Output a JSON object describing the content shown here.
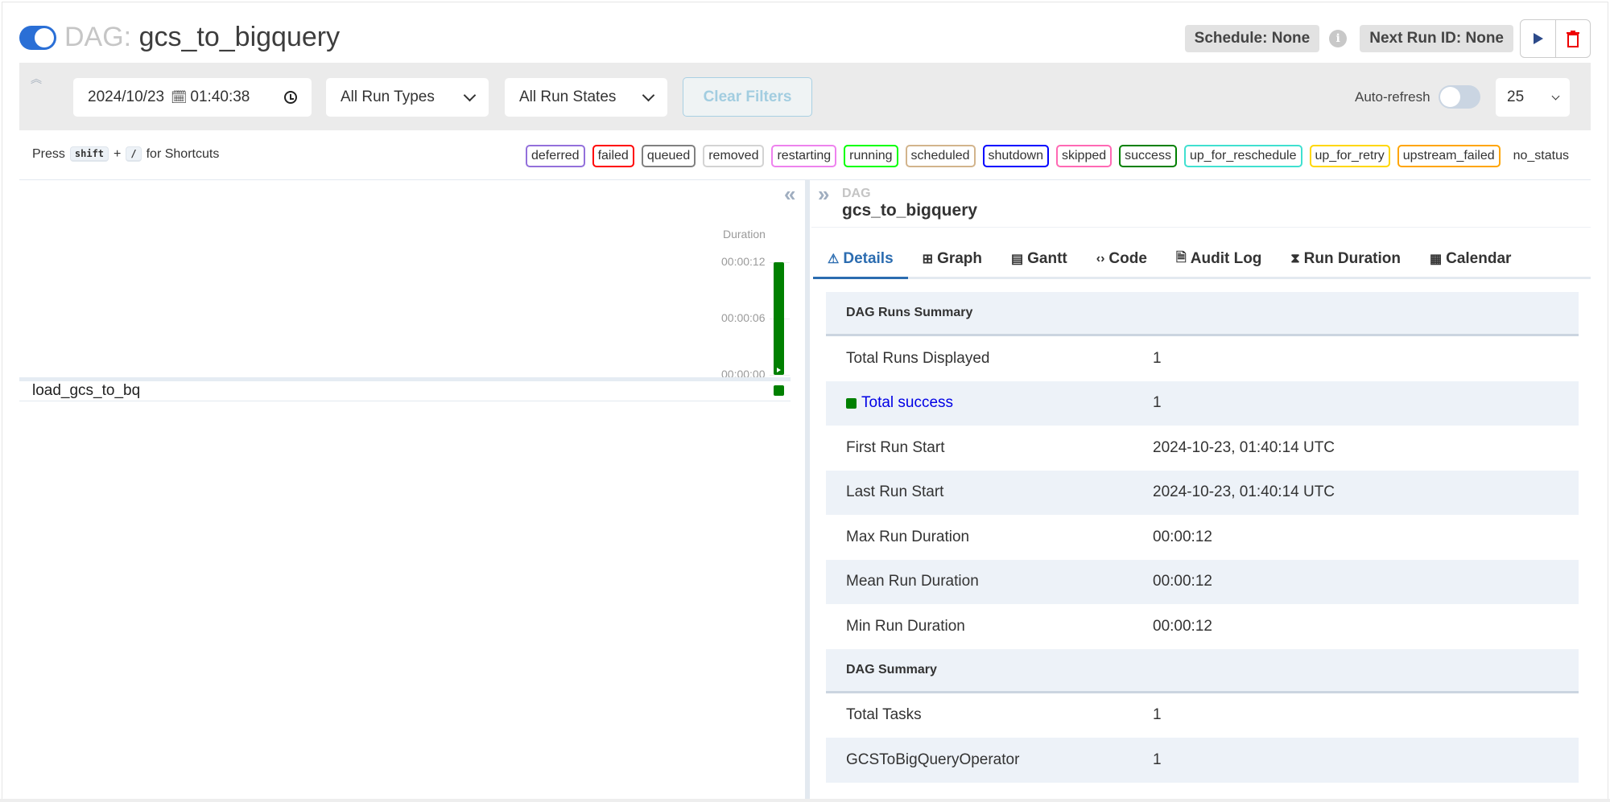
{
  "header": {
    "dag_prefix": "DAG:",
    "dag_id": "gcs_to_bigquery",
    "schedule": "Schedule: None",
    "next_run": "Next Run ID: None",
    "info_glyph": "i",
    "icons": {
      "toggle": "dag-active-toggle",
      "trigger": "play-icon",
      "delete": "trash-icon",
      "info": "info-icon"
    }
  },
  "filters": {
    "date": "2024/10/23",
    "time": "01:40:38",
    "run_types": "All Run Types",
    "run_states": "All Run States",
    "clear_label": "Clear Filters",
    "auto_refresh_label": "Auto-refresh",
    "auto_refresh_on": false,
    "num_runs": "25"
  },
  "shortcuts": {
    "press": "Press",
    "key1": "shift",
    "plus": "+",
    "key2": "/",
    "suffix": "for Shortcuts"
  },
  "states": [
    {
      "label": "deferred",
      "color": "#9370db"
    },
    {
      "label": "failed",
      "color": "#ff0000"
    },
    {
      "label": "queued",
      "color": "#808080"
    },
    {
      "label": "removed",
      "color": "#d3d3d3"
    },
    {
      "label": "restarting",
      "color": "#ee82ee"
    },
    {
      "label": "running",
      "color": "#00ff00"
    },
    {
      "label": "scheduled",
      "color": "#d2b48c"
    },
    {
      "label": "shutdown",
      "color": "#0000ff"
    },
    {
      "label": "skipped",
      "color": "#ff69b4"
    },
    {
      "label": "success",
      "color": "#008000"
    },
    {
      "label": "up_for_reschedule",
      "color": "#40e0d0"
    },
    {
      "label": "up_for_retry",
      "color": "#ffd700"
    },
    {
      "label": "upstream_failed",
      "color": "#ffa500"
    },
    {
      "label": "no_status",
      "color": null
    }
  ],
  "grid": {
    "duration_label": "Duration",
    "ticks": [
      "00:00:12",
      "00:00:06",
      "00:00:00"
    ],
    "runs": [
      {
        "duration_seconds": 12,
        "state": "success"
      }
    ],
    "max_seconds": 12,
    "tasks": [
      {
        "task_id": "load_gcs_to_bq",
        "state": "success"
      }
    ]
  },
  "details": {
    "small_label": "DAG",
    "dag_id": "gcs_to_bigquery",
    "tabs": [
      {
        "label": "Details",
        "icon": "⚠",
        "active": true
      },
      {
        "label": "Graph",
        "icon": "⊞",
        "active": false
      },
      {
        "label": "Gantt",
        "icon": "▤",
        "active": false
      },
      {
        "label": "Code",
        "icon": "‹›",
        "active": false
      },
      {
        "label": "Audit Log",
        "icon": "🗎",
        "active": false
      },
      {
        "label": "Run Duration",
        "icon": "⧗",
        "active": false
      },
      {
        "label": "Calendar",
        "icon": "▦",
        "active": false
      }
    ],
    "runs_summary_title": "DAG Runs Summary",
    "runs_summary": [
      {
        "key": "Total Runs Displayed",
        "value": "1"
      },
      {
        "key": "Total success",
        "value": "1",
        "link": true
      },
      {
        "key": "First Run Start",
        "value": "2024-10-23, 01:40:14 UTC"
      },
      {
        "key": "Last Run Start",
        "value": "2024-10-23, 01:40:14 UTC"
      },
      {
        "key": "Max Run Duration",
        "value": "00:00:12"
      },
      {
        "key": "Mean Run Duration",
        "value": "00:00:12"
      },
      {
        "key": "Min Run Duration",
        "value": "00:00:12"
      }
    ],
    "dag_summary_title": "DAG Summary",
    "dag_summary": [
      {
        "key": "Total Tasks",
        "value": "1"
      },
      {
        "key": "GCSToBigQueryOperator",
        "value": "1"
      }
    ]
  }
}
